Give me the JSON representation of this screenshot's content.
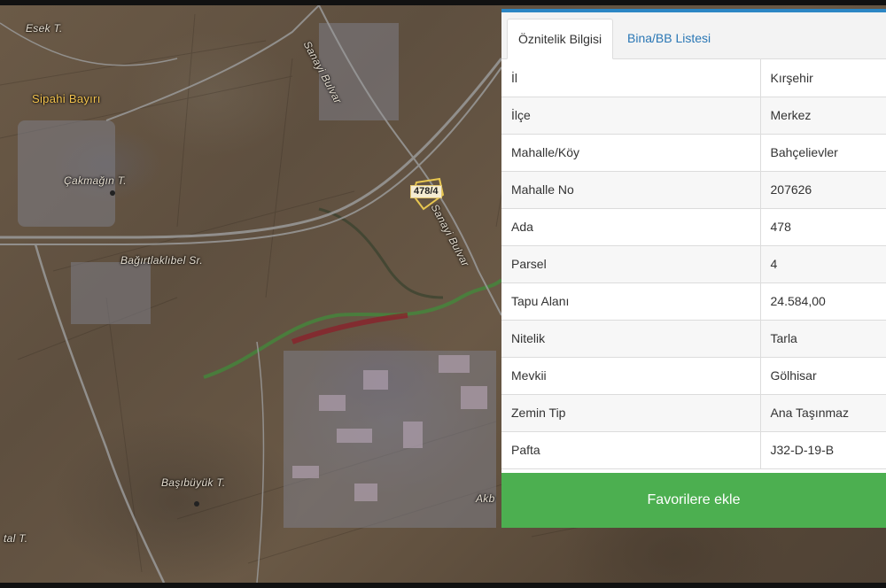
{
  "map": {
    "labels": {
      "esek": "Esek T.",
      "sipahi": "Sipahi Bayırı",
      "cakmagin": "Çakmağın T.",
      "sanayi1": "Sanayi Bulvar",
      "sanayi2": "Sanayi Bulvar",
      "bagirtlaklibel": "Bağırtlaklıbel Sr.",
      "basibuyuk": "Başıbüyük T.",
      "akb": "Akb",
      "tal": "tal T."
    },
    "parcel_tag": "478/4",
    "colors": {
      "roads": "#9a9a9a",
      "creek_green": "#3f8f3a",
      "creek_red": "#8c1f2a",
      "parcel_outline": "#e8c750"
    }
  },
  "panel": {
    "tabs": [
      {
        "label": "Öznitelik Bilgisi",
        "active": true
      },
      {
        "label": "Bina/BB Listesi",
        "active": false
      }
    ],
    "rows": [
      {
        "key": "İl",
        "value": "Kırşehir"
      },
      {
        "key": "İlçe",
        "value": "Merkez"
      },
      {
        "key": "Mahalle/Köy",
        "value": "Bahçelievler"
      },
      {
        "key": "Mahalle No",
        "value": "207626"
      },
      {
        "key": "Ada",
        "value": "478"
      },
      {
        "key": "Parsel",
        "value": "4"
      },
      {
        "key": "Tapu Alanı",
        "value": "24.584,00"
      },
      {
        "key": "Nitelik",
        "value": "Tarla"
      },
      {
        "key": "Mevkii",
        "value": "Gölhisar"
      },
      {
        "key": "Zemin Tip",
        "value": "Ana Taşınmaz"
      },
      {
        "key": "Pafta",
        "value": "J32-D-19-B"
      }
    ],
    "favorite_button": "Favorilere ekle",
    "colors": {
      "accent": "#2c86c4",
      "button": "#4caf50",
      "tab_link": "#2a77b5"
    }
  }
}
